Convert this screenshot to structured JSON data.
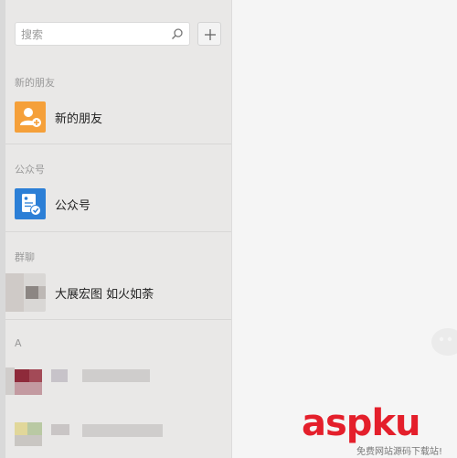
{
  "search": {
    "placeholder": "搜索"
  },
  "sections": {
    "new_friends": {
      "title": "新的朋友",
      "item_label": "新的朋友"
    },
    "official_accounts": {
      "title": "公众号",
      "item_label": "公众号"
    },
    "group_chats": {
      "title": "群聊",
      "item_label": "大展宏图 如火如荼"
    },
    "contacts_a": {
      "title": "A"
    }
  },
  "icons": {
    "search": "search-icon",
    "add": "plus-icon",
    "new_friend": "add-friend-icon",
    "official": "official-account-icon"
  },
  "colors": {
    "new_friend_icon": "#f5a03a",
    "official_icon": "#2c7fd6",
    "watermark": "#e41f2b"
  },
  "watermark": {
    "main_prefix": "asp",
    "main_suffix": "ku",
    "sub": "免费网站源码下载站!"
  }
}
